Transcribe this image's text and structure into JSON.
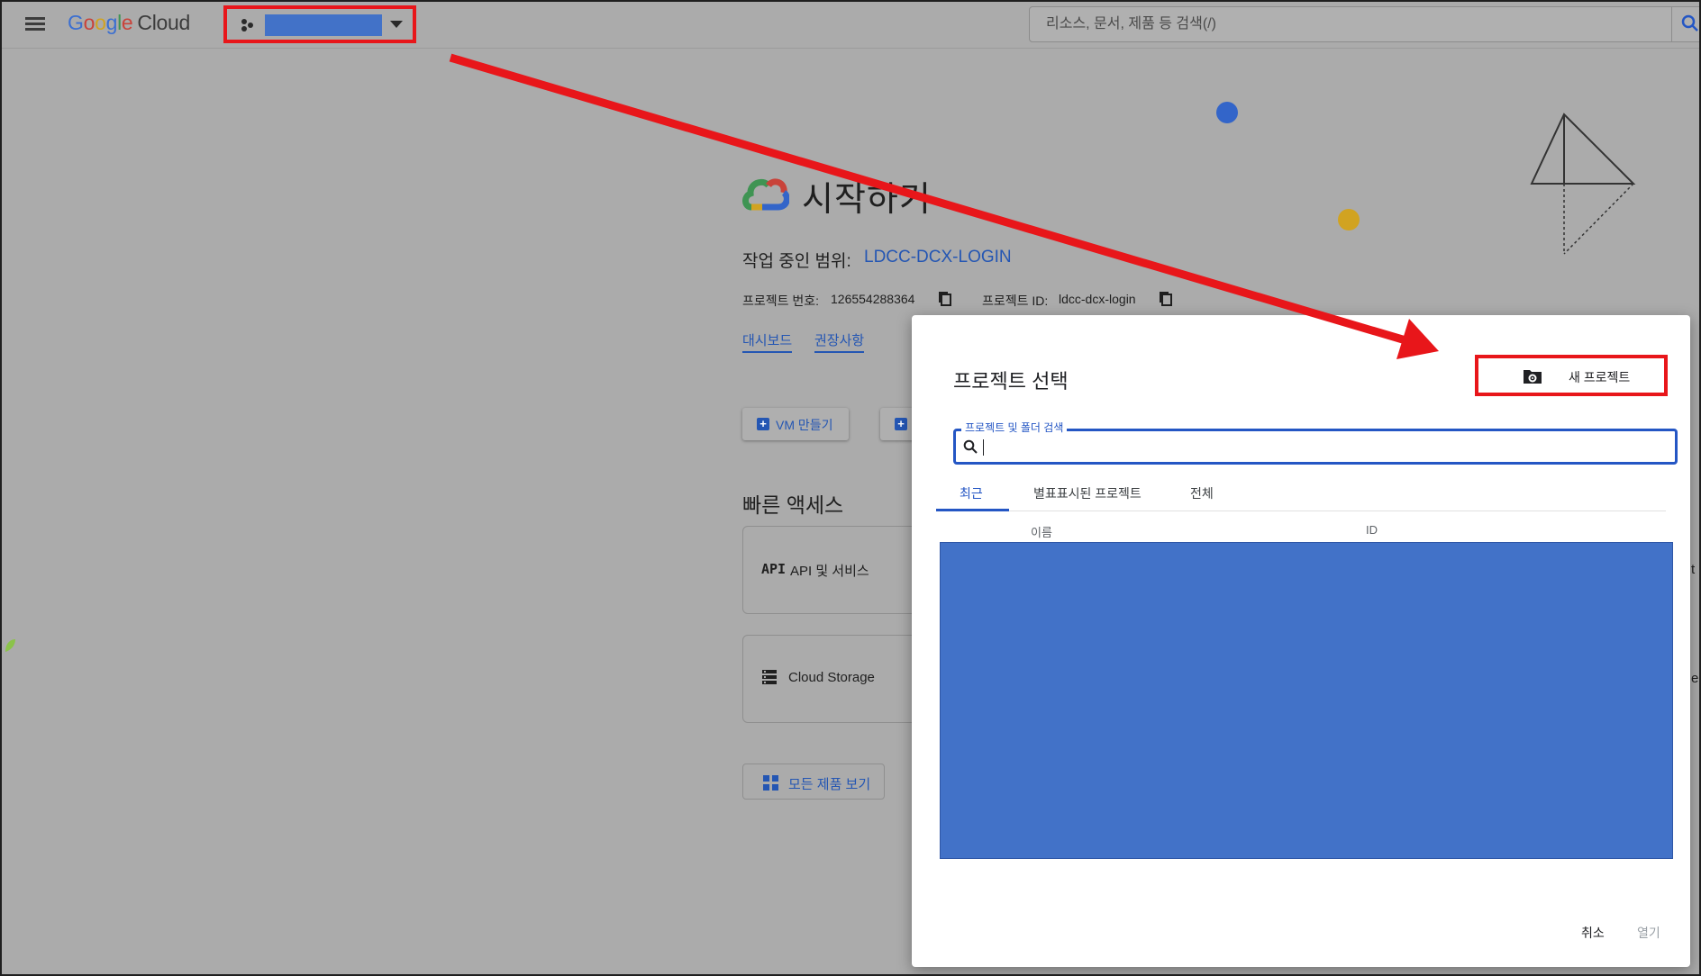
{
  "topbar": {
    "brand": {
      "g1": "G",
      "g2": "o",
      "g3": "o",
      "g4": "g",
      "g5": "l",
      "g6": "e",
      "cloud": "Cloud"
    },
    "search_placeholder": "리소스, 문서, 제품 등 검색(/)"
  },
  "getting_started": {
    "title": "시작하기",
    "scope_label": "작업 중인 범위:",
    "scope_value": "LDCC-DCX-LOGIN",
    "project_number_label": "프로젝트 번호:",
    "project_number_value": "126554288364",
    "project_id_label": "프로젝트 ID:",
    "project_id_value": "ldcc-dcx-login",
    "links": {
      "dashboard": "대시보드",
      "recommendations": "권장사항"
    },
    "vm_button": "VM 만들기",
    "quick_access_title": "빠른 액세스",
    "quick_access": {
      "api": {
        "icon": "API",
        "label": "API 및 서비스"
      },
      "storage": {
        "label": "Cloud Storage"
      }
    },
    "all_products": "모든 제품 보기",
    "edge_t": "t",
    "edge_e": "e"
  },
  "dialog": {
    "title": "프로젝트 선택",
    "new_project": "새 프로젝트",
    "search_label": "프로젝트 및 폴더 검색",
    "tabs": {
      "recent": "최근",
      "starred": "별표표시된 프로젝트",
      "all": "전체"
    },
    "columns": {
      "name": "이름",
      "id": "ID"
    },
    "cancel": "취소",
    "open": "열기"
  },
  "colors": {
    "annotation_red": "#e8161a",
    "redaction_blue": "#4272c8",
    "link_blue": "#2456b3",
    "backdrop": "#ababab"
  },
  "icons": {
    "menu": "menu-icon",
    "project_selector": "project-dots-icon",
    "search": "search-icon",
    "copy": "copy-icon",
    "new_project": "folder-gear-icon",
    "storage": "storage-icon",
    "apps": "grid-icon"
  }
}
